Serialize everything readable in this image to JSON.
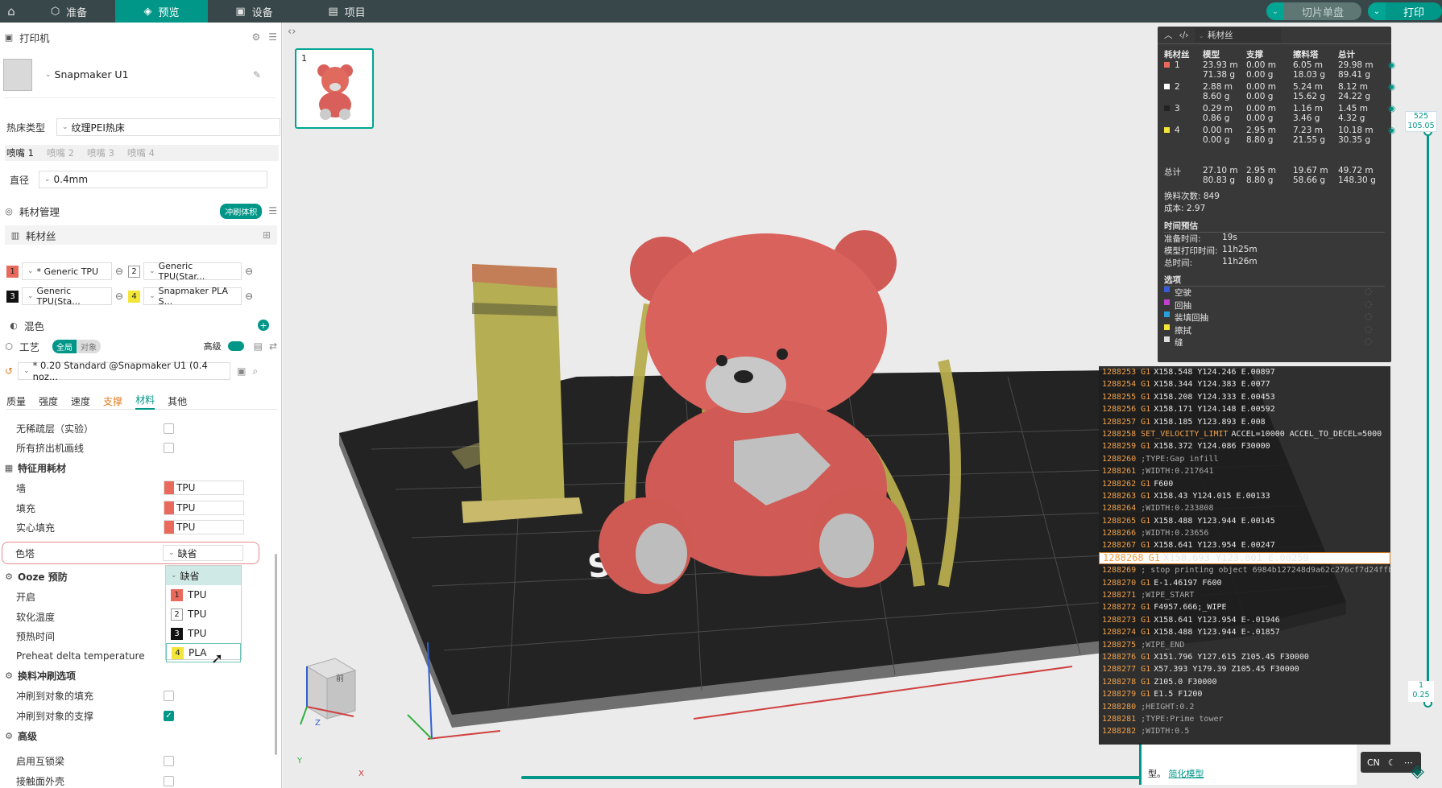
{
  "topbar": {
    "tabs": [
      {
        "label": "准备",
        "icon": "cube-icon"
      },
      {
        "label": "预览",
        "icon": "layers-icon"
      },
      {
        "label": "设备",
        "icon": "monitor-icon"
      },
      {
        "label": "项目",
        "icon": "grid-icon"
      }
    ],
    "slice_label": "切片单盘",
    "print_label": "打印"
  },
  "sidebar": {
    "printer_title": "打印机",
    "printer_name": "Snapmaker U1",
    "bed_type_label": "热床类型",
    "bed_type_value": "纹理PEI热床",
    "nozzles": [
      "喷嘴 1",
      "喷嘴 2",
      "喷嘴 3",
      "喷嘴 4"
    ],
    "diameter_label": "直径",
    "diameter_value": "0.4mm",
    "filament_mgmt": "耗材管理",
    "flush_volume": "冲刷体积",
    "filament_label": "耗材丝",
    "filaments": [
      {
        "n": "1",
        "name": "* Generic TPU",
        "color": "#e96a5c"
      },
      {
        "n": "2",
        "name": "Generic TPU(Star...",
        "color": "#ffffff"
      },
      {
        "n": "3",
        "name": "Generic TPU(Sta...",
        "color": "#111111"
      },
      {
        "n": "4",
        "name": "Snapmaker PLA S...",
        "color": "#f3e53a"
      }
    ],
    "mix_label": "混色",
    "process_label": "工艺",
    "global_label": "全局",
    "object_label": "对象",
    "advanced_label": "高级",
    "profile": "* 0.20 Standard @Snapmaker U1 (0.4 noz...",
    "tabs": [
      "质量",
      "强度",
      "速度",
      "支撑",
      "材料",
      "其他"
    ],
    "settings": [
      {
        "label": "无稀疏层（实验）",
        "type": "cb",
        "on": false
      },
      {
        "label": "所有挤出机画线",
        "type": "cb",
        "on": false
      }
    ],
    "feature_title": "特征用耗材",
    "features": [
      {
        "label": "墙",
        "value": "TPU"
      },
      {
        "label": "填充",
        "value": "TPU"
      },
      {
        "label": "实心填充",
        "value": "TPU"
      }
    ],
    "tower_label": "色塔",
    "tower_value": "缺省",
    "ooze_title": "Ooze 预防",
    "ooze_items": [
      "开启",
      "软化温度",
      "预热时间",
      "Preheat delta temperature"
    ],
    "flush_title": "换料冲刷选项",
    "flush_items": [
      {
        "label": "冲刷到对象的填充",
        "on": false
      },
      {
        "label": "冲刷到对象的支撑",
        "on": true
      }
    ],
    "adv_title": "高级",
    "adv_items": [
      {
        "label": "启用互锁梁",
        "on": false
      },
      {
        "label": "接触面外壳",
        "on": false
      }
    ],
    "dropdown": [
      {
        "label": "缺省",
        "n": ""
      },
      {
        "label": "TPU",
        "n": "1"
      },
      {
        "label": "TPU",
        "n": "2"
      },
      {
        "label": "TPU",
        "n": "3"
      },
      {
        "label": "PLA",
        "n": "4"
      }
    ]
  },
  "plate_number": "1",
  "stats": {
    "title": "耗材丝",
    "headers": [
      "耗材丝",
      "模型",
      "支撑",
      "擦料塔",
      "总计"
    ],
    "rows": [
      {
        "id": "1",
        "color": "#e96a5c",
        "model": [
          "23.93 m",
          "71.38 g"
        ],
        "support": [
          "0.00 m",
          "0.00 g"
        ],
        "tower": [
          "6.05 m",
          "18.03 g"
        ],
        "total": [
          "29.98 m",
          "89.41 g"
        ]
      },
      {
        "id": "2",
        "color": "#ffffff",
        "model": [
          "2.88 m",
          "8.60 g"
        ],
        "support": [
          "0.00 m",
          "0.00 g"
        ],
        "tower": [
          "5.24 m",
          "15.62 g"
        ],
        "total": [
          "8.12 m",
          "24.22 g"
        ]
      },
      {
        "id": "3",
        "color": "#222222",
        "model": [
          "0.29 m",
          "0.86 g"
        ],
        "support": [
          "0.00 m",
          "0.00 g"
        ],
        "tower": [
          "1.16 m",
          "3.46 g"
        ],
        "total": [
          "1.45 m",
          "4.32 g"
        ]
      },
      {
        "id": "4",
        "color": "#f3e53a",
        "model": [
          "0.00 m",
          "0.00 g"
        ],
        "support": [
          "2.95 m",
          "8.80 g"
        ],
        "tower": [
          "7.23 m",
          "21.55 g"
        ],
        "total": [
          "10.18 m",
          "30.35 g"
        ]
      }
    ],
    "total_label": "总计",
    "total": {
      "model": [
        "27.10 m",
        "80.83 g"
      ],
      "support": [
        "2.95 m",
        "8.80 g"
      ],
      "tower": [
        "19.67 m",
        "58.66 g"
      ],
      "total": [
        "49.72 m",
        "148.30 g"
      ]
    },
    "changes": "换料次数: 849",
    "cost": "成本: 2.97",
    "time_title": "时间预估",
    "prep_label": "准备时间:",
    "prep_value": "19s",
    "model_time_label": "模型打印时间:",
    "model_time_value": "11h25m",
    "total_time_label": "总时间:",
    "total_time_value": "11h26m",
    "options_title": "选项",
    "options": [
      {
        "label": "空驶",
        "color": "#3a5bd8"
      },
      {
        "label": "回抽",
        "color": "#c040d0"
      },
      {
        "label": "装填回抽",
        "color": "#2aa0d8"
      },
      {
        "label": "擦拭",
        "color": "#f3e53a"
      },
      {
        "label": "缝",
        "color": "#dddddd"
      }
    ]
  },
  "gcode": [
    {
      "n": "1288253",
      "c": "G1",
      "t": "X158.548 Y124.246 E.00897"
    },
    {
      "n": "1288254",
      "c": "G1",
      "t": "X158.344 Y124.383 E.0077"
    },
    {
      "n": "1288255",
      "c": "G1",
      "t": "X158.208 Y124.333 E.00453"
    },
    {
      "n": "1288256",
      "c": "G1",
      "t": "X158.171 Y124.148 E.00592"
    },
    {
      "n": "1288257",
      "c": "G1",
      "t": "X158.185 Y123.893 E.008"
    },
    {
      "n": "1288258",
      "c": "SET_VELOCITY_LIMIT",
      "t": "ACCEL=10000 ACCEL_TO_DECEL=5000"
    },
    {
      "n": "1288259",
      "c": "G1",
      "t": "X158.372 Y124.086 F30000"
    },
    {
      "n": "1288260",
      "c": "",
      "t": ";TYPE:Gap infill"
    },
    {
      "n": "1288261",
      "c": "",
      "t": ";WIDTH:0.217641"
    },
    {
      "n": "1288262",
      "c": "G1",
      "t": "F600"
    },
    {
      "n": "1288263",
      "c": "G1",
      "t": "X158.43 Y124.015 E.00133"
    },
    {
      "n": "1288264",
      "c": "",
      "t": ";WIDTH:0.233808"
    },
    {
      "n": "1288265",
      "c": "G1",
      "t": "X158.488 Y123.944 E.00145"
    },
    {
      "n": "1288266",
      "c": "",
      "t": ";WIDTH:0.23656"
    },
    {
      "n": "1288267",
      "c": "G1",
      "t": "X158.641 Y123.954 E.00247"
    },
    {
      "n": "1288268",
      "c": "G1",
      "t": "X158.693 Y123.801 E.00259"
    },
    {
      "n": "1288269",
      "c": "",
      "t": "; stop printing object 6984b127248d9a62c276cf7d24ffb..."
    },
    {
      "n": "1288270",
      "c": "G1",
      "t": "E-1.46197 F600"
    },
    {
      "n": "1288271",
      "c": "",
      "t": ";WIPE_START"
    },
    {
      "n": "1288272",
      "c": "G1",
      "t": "F4957.666;_WIPE"
    },
    {
      "n": "1288273",
      "c": "G1",
      "t": "X158.641 Y123.954 E-.01946"
    },
    {
      "n": "1288274",
      "c": "G1",
      "t": "X158.488 Y123.944 E-.01857"
    },
    {
      "n": "1288275",
      "c": "",
      "t": ";WIPE_END"
    },
    {
      "n": "1288276",
      "c": "G1",
      "t": "X151.796 Y127.615 Z105.45 F30000"
    },
    {
      "n": "1288277",
      "c": "G1",
      "t": "X57.393 Y179.39 Z105.45 F30000"
    },
    {
      "n": "1288278",
      "c": "G1",
      "t": "Z105.0 F30000"
    },
    {
      "n": "1288279",
      "c": "G1",
      "t": "E1.5 F1200"
    },
    {
      "n": "1288280",
      "c": "",
      "t": ";HEIGHT:0.2"
    },
    {
      "n": "1288281",
      "c": "",
      "t": ";TYPE:Prime tower"
    },
    {
      "n": "1288282",
      "c": "",
      "t": ";WIDTH:0.5"
    }
  ],
  "slider": {
    "top_layer": "525",
    "top_height": "105.05",
    "bottom_layer": "1",
    "bottom_height": "0.25",
    "move_value": "65"
  },
  "notice": {
    "text": "型。",
    "link": "简化模型"
  },
  "lang": "CN",
  "axis": {
    "cube_face": "前",
    "x": "X",
    "y": "Y",
    "z": "Z"
  }
}
